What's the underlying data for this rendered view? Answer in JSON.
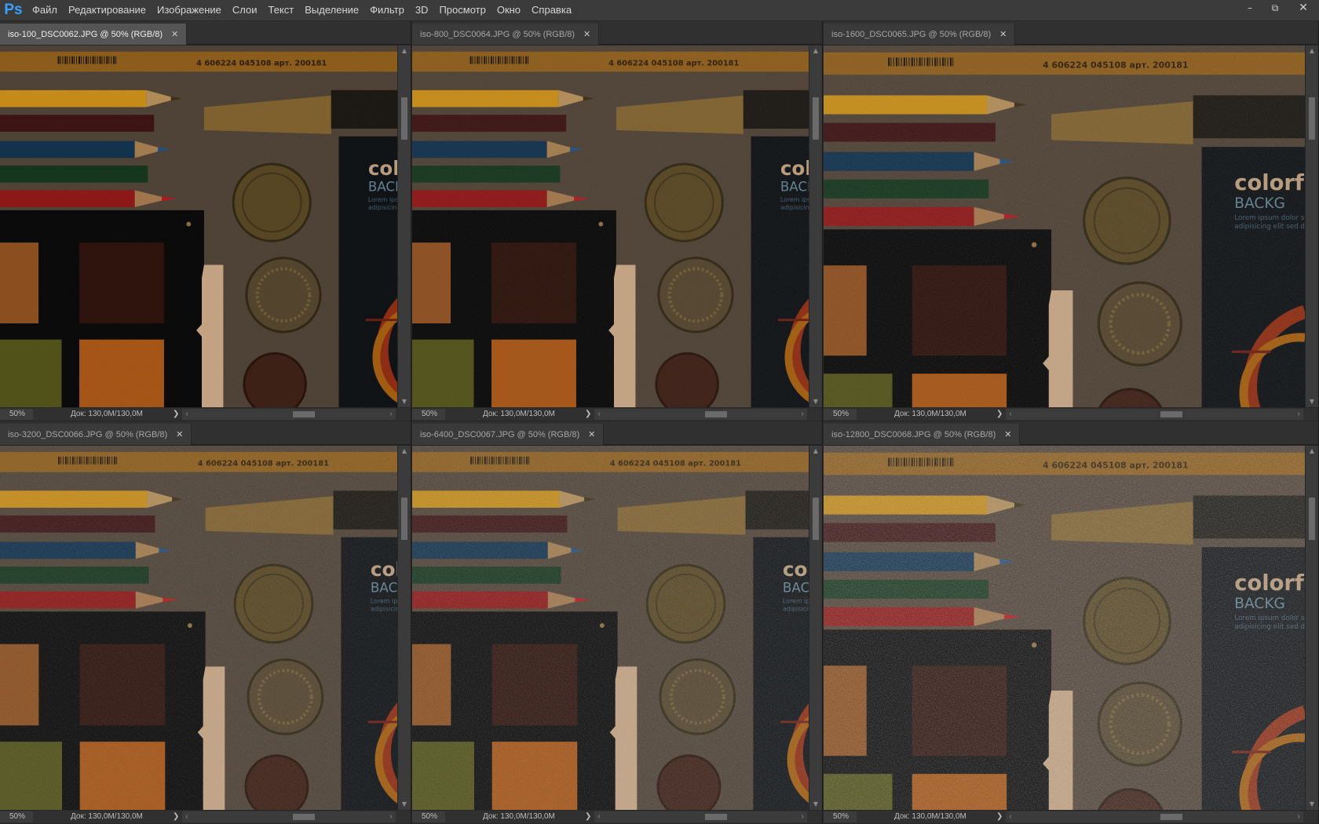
{
  "app": {
    "logo": "Ps"
  },
  "menu": [
    "Файл",
    "Редактирование",
    "Изображение",
    "Слои",
    "Текст",
    "Выделение",
    "Фильтр",
    "3D",
    "Просмотр",
    "Окно",
    "Справка"
  ],
  "window_controls": {
    "minimize": "–",
    "restore": "⧉",
    "close": "✕"
  },
  "documents": [
    {
      "title": "iso-100_DSC0062.JPG @ 50% (RGB/8)",
      "zoom": "50%",
      "info": "Док: 130,0M/130,0M",
      "active": true,
      "noise": 0.05
    },
    {
      "title": "iso-800_DSC0064.JPG @ 50% (RGB/8)",
      "zoom": "50%",
      "info": "Док: 130,0M/130,0M",
      "active": false,
      "noise": 0.12
    },
    {
      "title": "iso-1600_DSC0065.JPG @ 50% (RGB/8)",
      "zoom": "50%",
      "info": "Док: 130,0M/130,0M",
      "active": false,
      "noise": 0.18
    },
    {
      "title": "iso-3200_DSC0066.JPG @ 50% (RGB/8)",
      "zoom": "50%",
      "info": "Док: 130,0M/130,0M",
      "active": false,
      "noise": 0.25
    },
    {
      "title": "iso-6400_DSC0067.JPG @ 50% (RGB/8)",
      "zoom": "50%",
      "info": "Док: 130,0M/130,0M",
      "active": false,
      "noise": 0.33
    },
    {
      "title": "iso-12800_DSC0068.JPG @ 50% (RGB/8)",
      "zoom": "50%",
      "info": "Док: 130,0M/130,0M",
      "active": false,
      "noise": 0.45
    }
  ],
  "photo_text": {
    "barcode_number": "4 606224 045108 арт. 200181",
    "brand": "colorf",
    "brand_sub": "BACKG",
    "lorem_1": "Lorem ipsum dolor sit",
    "lorem_2": "adipisicing elit sed do"
  },
  "status_arrows": {
    "right": "❯",
    "left": "‹",
    "right_small": "›",
    "up": "▲",
    "down": "▼"
  },
  "colors": {
    "accent": "#3aa0ff",
    "menubar": "#3b3b3b",
    "tab_active": "#555555"
  }
}
